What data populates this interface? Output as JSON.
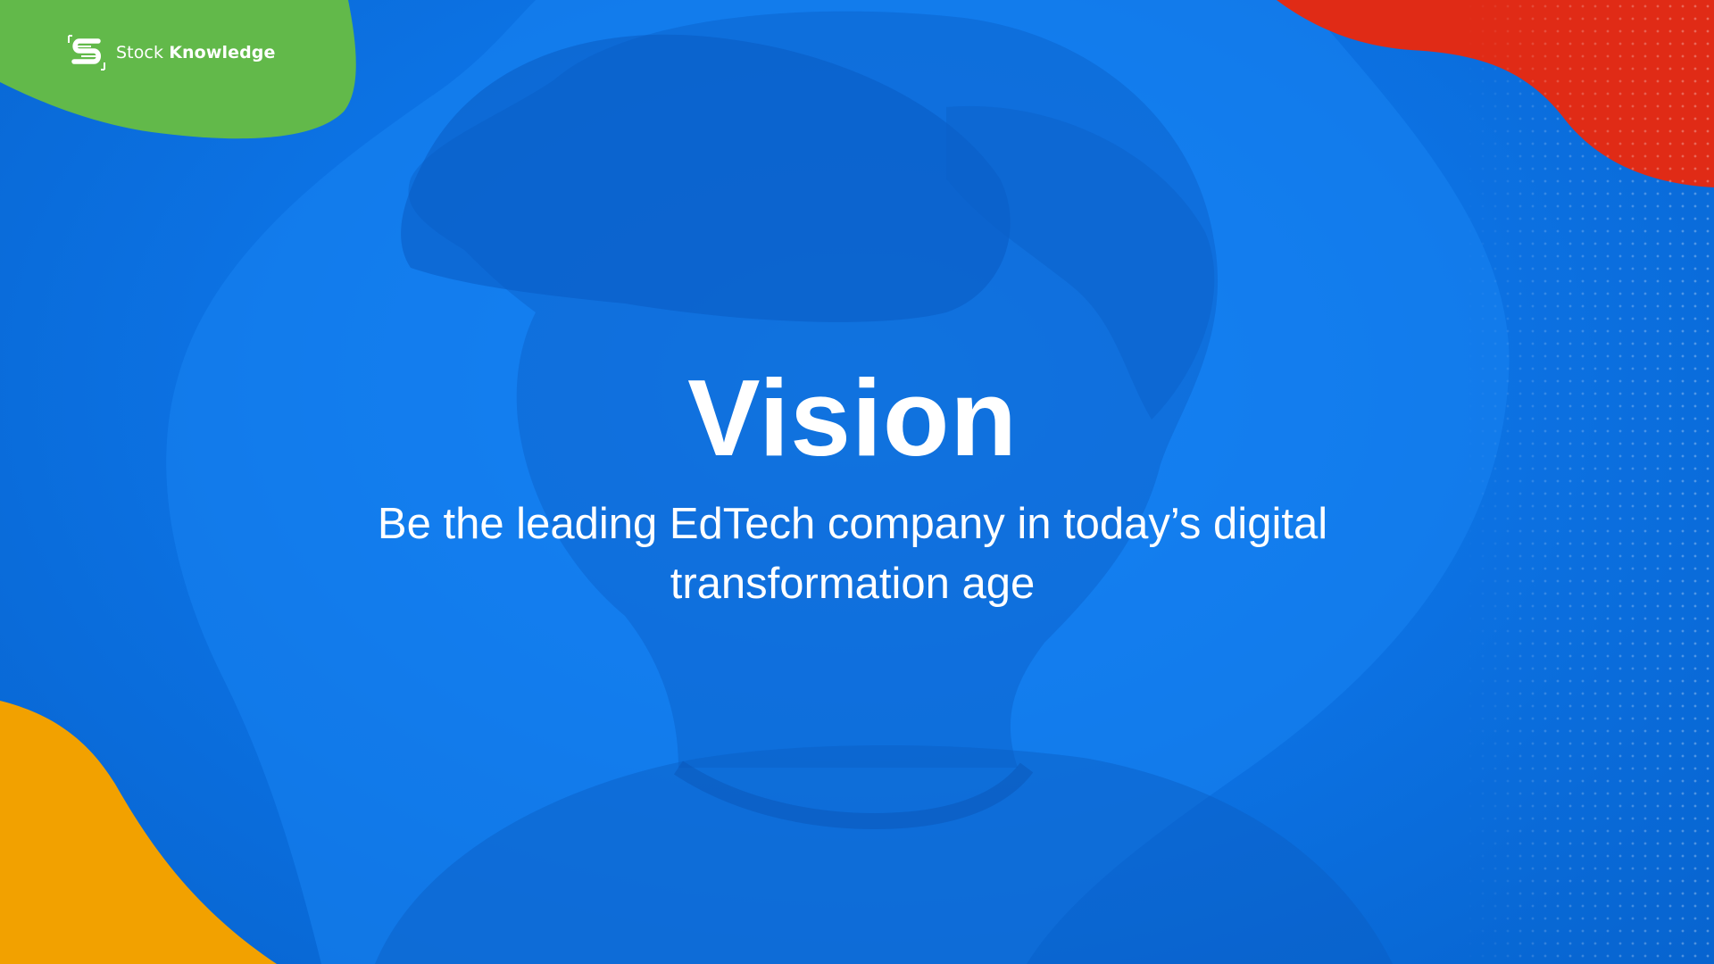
{
  "logo": {
    "name_light": "Stock",
    "name_bold": "Knowledge",
    "icon": "stock-knowledge-logo-icon"
  },
  "slide": {
    "title": "Vision",
    "subtitle": "Be the leading EdTech company in today’s digital transformation age"
  },
  "colors": {
    "background": "#0d74e6",
    "green_blob": "#62b94a",
    "red_blob": "#e02b16",
    "orange_blob": "#f2a100",
    "text": "#ffffff"
  }
}
